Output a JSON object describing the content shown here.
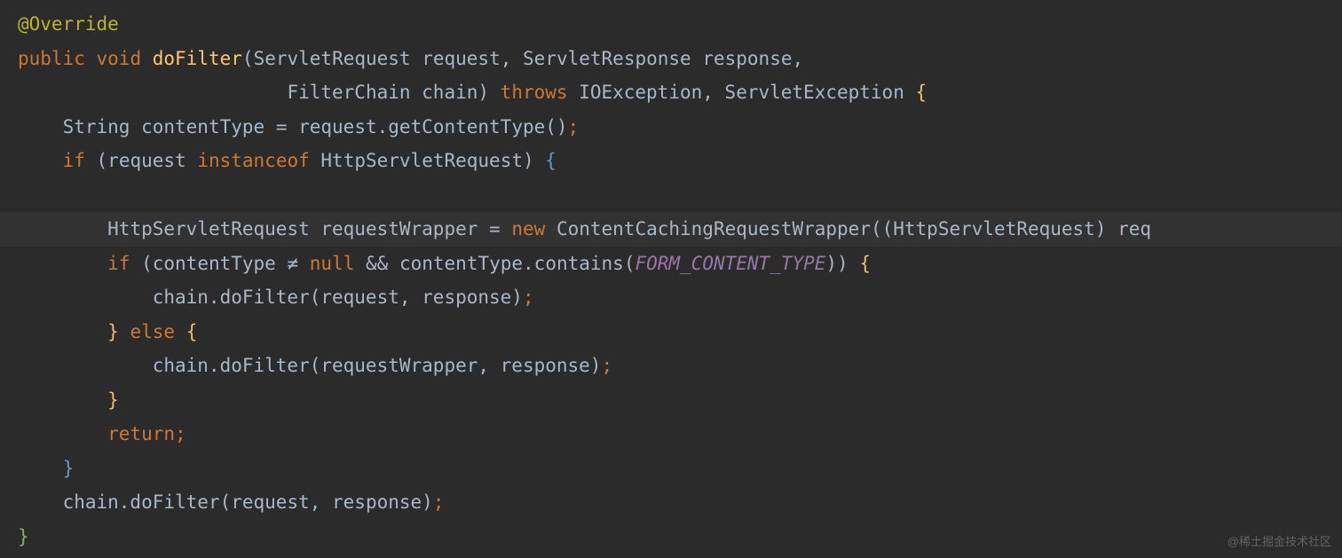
{
  "code": {
    "line1": {
      "annotation": "@Override"
    },
    "line2": {
      "kw_public": "public",
      "kw_void": "void",
      "method": "doFilter",
      "p1": "(",
      "type1": "ServletRequest",
      "param1": " request",
      "comma1": ", ",
      "type2": "ServletResponse",
      "param2": " response",
      "comma2": ","
    },
    "line3": {
      "indent": "                        ",
      "type3": "FilterChain",
      "param3": " chain",
      "p2": ") ",
      "kw_throws": "throws",
      "ex1": " IOException",
      "comma3": ", ",
      "ex2": "ServletException ",
      "brace": "{"
    },
    "line4": {
      "indent": "    ",
      "type": "String",
      "var": " contentType ",
      "eq": "=",
      "expr": " request.getContentType()",
      "semi": ";"
    },
    "line5": {
      "indent": "    ",
      "kw_if": "if",
      "p1": " (",
      "var": "request ",
      "kw_instanceof": "instanceof",
      "type": " HttpServletRequest",
      "p2": ") ",
      "brace": "{"
    },
    "line6": {
      "blank": ""
    },
    "line7": {
      "indent": "        ",
      "type1": "HttpServletRequest",
      "var": " requestWrapper ",
      "eq": "=",
      "sp": " ",
      "kw_new": "new",
      "sp2": " ",
      "ctor": "ContentCachingRequestWrapper",
      "p1": "((",
      "type2": "HttpServletRequest",
      "p2": ") ",
      "tail": "req"
    },
    "line8": {
      "indent": "        ",
      "kw_if": "if",
      "p1": " (",
      "var1": "contentType ",
      "neq": "≠",
      "sp1": " ",
      "null": "null",
      "sp2": " ",
      "and": "&&",
      "call": " contentType.contains(",
      "constant": "FORM_CONTENT_TYPE",
      "p2": ")) ",
      "brace": "{"
    },
    "line9": {
      "indent": "            ",
      "call": "chain.doFilter(request, response)",
      "semi": ";"
    },
    "line10": {
      "indent": "        ",
      "brace_close": "}",
      "sp": " ",
      "kw_else": "else",
      "sp2": " ",
      "brace_open": "{"
    },
    "line11": {
      "indent": "            ",
      "call": "chain.doFilter(requestWrapper, response)",
      "semi": ";"
    },
    "line12": {
      "indent": "        ",
      "brace": "}"
    },
    "line13": {
      "indent": "        ",
      "kw_return": "return",
      "semi": ";"
    },
    "line14": {
      "indent": "    ",
      "brace": "}"
    },
    "line15": {
      "indent": "    ",
      "call": "chain.doFilter(request, response)",
      "semi": ";"
    },
    "line16": {
      "brace": "}"
    }
  },
  "watermark": "@稀土掘金技术社区"
}
